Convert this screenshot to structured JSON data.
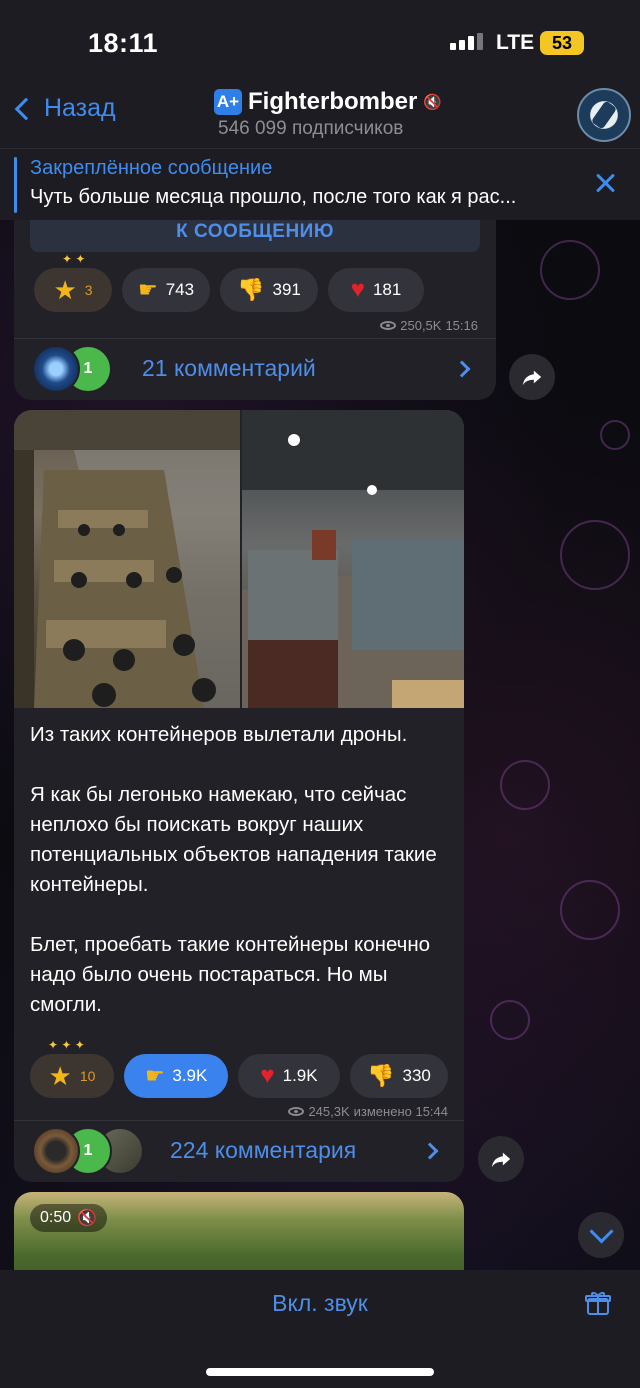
{
  "status_bar": {
    "time": "18:11",
    "network": "LTE",
    "battery": "53"
  },
  "header": {
    "back_label": "Назад",
    "channel_name": "Fighterbomber",
    "channel_badge": "A+",
    "subscribers": "546 099 подписчиков",
    "muted_icon": "mute-icon"
  },
  "pinned": {
    "title": "Закреплённое сообщение",
    "text": "Чуть больше месяца прошло, после того как я рас..."
  },
  "post1": {
    "goto_button": "К СООБЩЕНИЮ",
    "star_count": "3",
    "reactions": [
      {
        "icon": "pointing-hand-icon",
        "count": "743"
      },
      {
        "icon": "thumbs-down-icon",
        "count": "391"
      },
      {
        "icon": "heart-icon",
        "count": "181"
      }
    ],
    "views": "250,5K",
    "time": "15:16",
    "comments_badge": "1",
    "comments_label": "21 комментарий"
  },
  "post2": {
    "text": "Из таких контейнеров вылетали дроны.\n\nЯ как бы легонько намекаю, что сейчас неплохо бы поискать вокруг наших потенциальных объектов нападения такие контейнеры.\n\nБлет, проебать такие контейнеры конечно надо было очень постараться. Но мы смогли.",
    "star_count": "10",
    "reactions": [
      {
        "icon": "pointing-hand-icon",
        "count": "3.9K",
        "active": true
      },
      {
        "icon": "heart-icon",
        "count": "1.9K"
      },
      {
        "icon": "thumbs-down-icon",
        "count": "330"
      }
    ],
    "views": "245,3K",
    "edited_time": "изменено 15:44",
    "comments_badge": "1",
    "comments_label": "224 комментария"
  },
  "post3": {
    "video_duration": "0:50"
  },
  "bottom": {
    "unmute_label": "Вкл. звук"
  },
  "colors": {
    "accent": "#3f8cf0",
    "bubble": "#212127",
    "active_reaction": "#3a82ee"
  }
}
